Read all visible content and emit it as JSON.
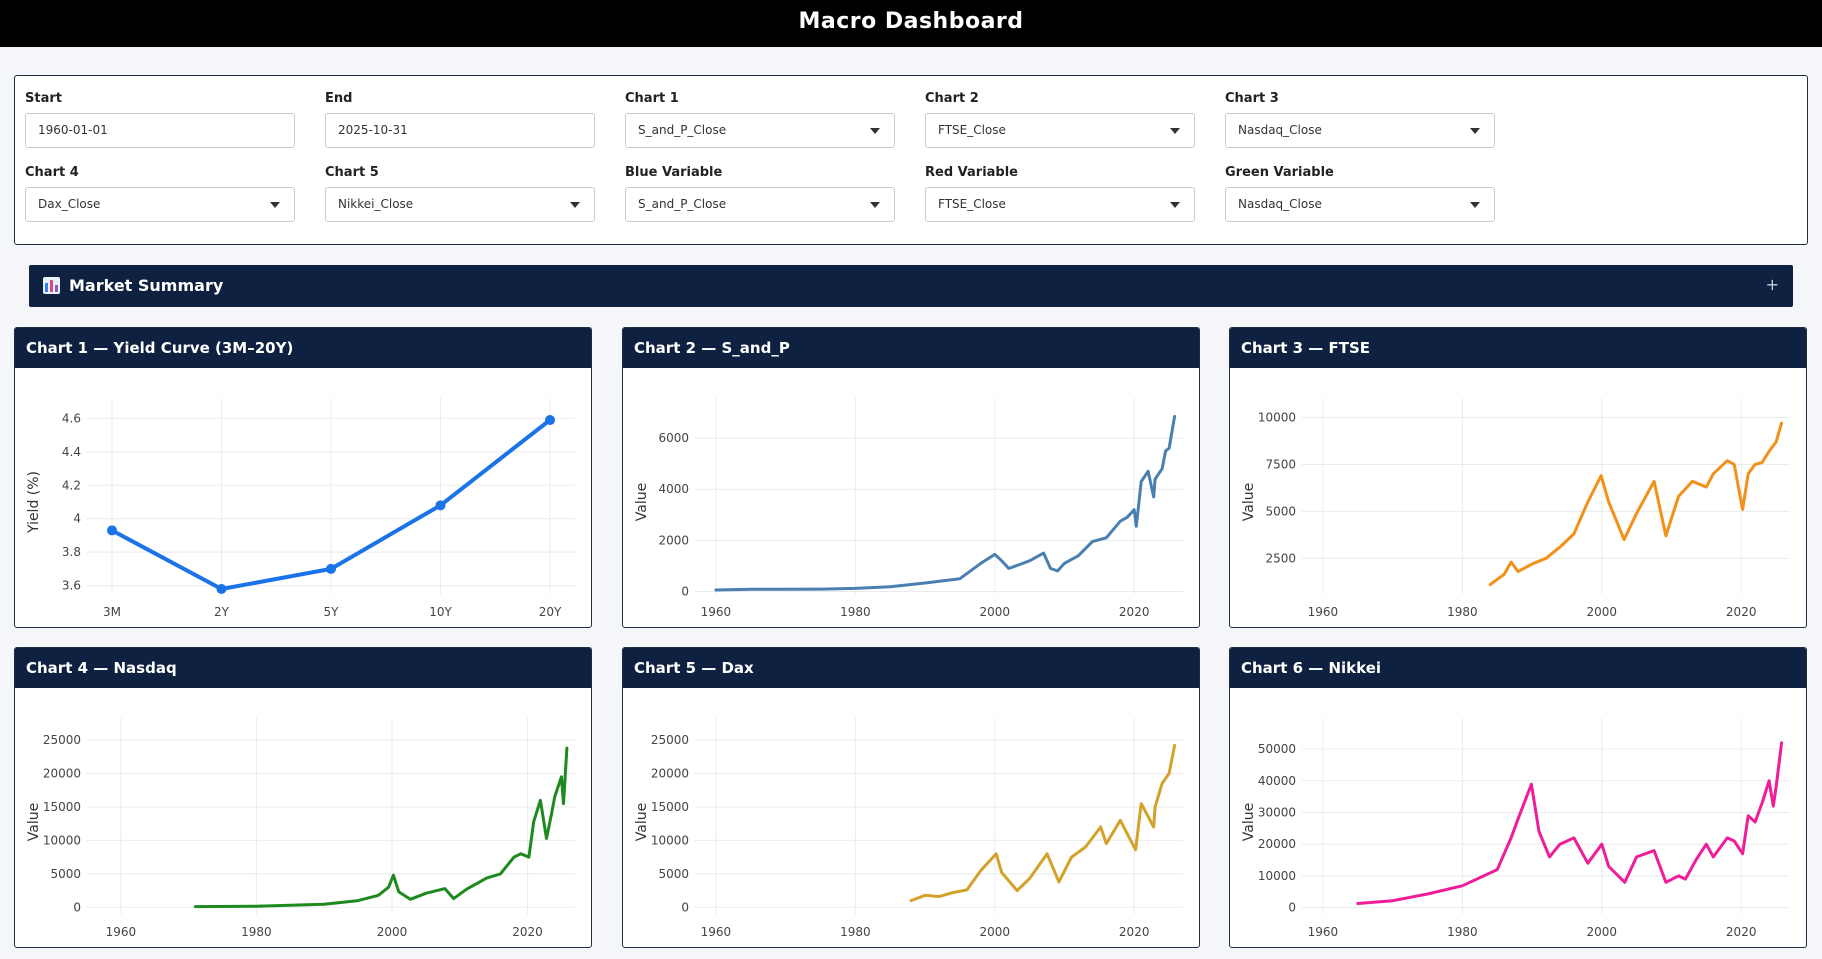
{
  "app": {
    "title": "Macro Dashboard"
  },
  "controls": {
    "start": {
      "label": "Start",
      "value": "1960-01-01"
    },
    "end": {
      "label": "End",
      "value": "2025-10-31"
    },
    "chart1": {
      "label": "Chart 1",
      "value": "S_and_P_Close"
    },
    "chart2": {
      "label": "Chart 2",
      "value": "FTSE_Close"
    },
    "chart3": {
      "label": "Chart 3",
      "value": "Nasdaq_Close"
    },
    "chart4": {
      "label": "Chart 4",
      "value": "Dax_Close"
    },
    "chart5": {
      "label": "Chart 5",
      "value": "Nikkei_Close"
    },
    "blue": {
      "label": "Blue Variable",
      "value": "S_and_P_Close"
    },
    "red": {
      "label": "Red Variable",
      "value": "FTSE_Close"
    },
    "green": {
      "label": "Green Variable",
      "value": "Nasdaq_Close"
    }
  },
  "summary": {
    "title": "Market Summary",
    "toggle": "+"
  },
  "cards": {
    "c1": "Chart 1 — Yield Curve (3M–20Y)",
    "c2": "Chart 2 — S_and_P",
    "c3": "Chart 3 — FTSE",
    "c4": "Chart 4 — Nasdaq",
    "c5": "Chart 5 — Dax",
    "c6": "Chart 6 — Nikkei"
  },
  "chart_data": [
    {
      "id": "c1",
      "type": "line",
      "ylabel": "Yield (%)",
      "color": "#1a73e8",
      "markers": true,
      "categories": [
        "3M",
        "2Y",
        "5Y",
        "10Y",
        "20Y"
      ],
      "values": [
        3.93,
        3.58,
        3.7,
        4.08,
        4.59
      ],
      "ylim": [
        3.55,
        4.65
      ],
      "yticks": [
        3.6,
        3.8,
        4.0,
        4.2,
        4.4,
        4.6
      ]
    },
    {
      "id": "c2",
      "type": "line",
      "ylabel": "Value",
      "color": "#4a7fb0",
      "xlim": [
        1957,
        2027
      ],
      "xticks": [
        1960,
        1980,
        2000,
        2020
      ],
      "ylim": [
        -100,
        7100
      ],
      "yticks": [
        0,
        2000,
        4000,
        6000
      ],
      "x": [
        1960,
        1965,
        1970,
        1975,
        1980,
        1985,
        1990,
        1995,
        1997,
        1998,
        2000,
        2001,
        2002,
        2003,
        2005,
        2007,
        2008,
        2009,
        2010,
        2012,
        2014,
        2016,
        2018,
        2019,
        2020,
        2020.3,
        2021,
        2022,
        2022.8,
        2023,
        2024,
        2024.5,
        2025,
        2025.8
      ],
      "y": [
        57,
        88,
        83,
        90,
        118,
        180,
        330,
        500,
        900,
        1100,
        1450,
        1200,
        900,
        1000,
        1200,
        1500,
        900,
        800,
        1100,
        1400,
        1950,
        2100,
        2750,
        2900,
        3200,
        2550,
        4300,
        4700,
        3700,
        4400,
        4800,
        5500,
        5600,
        6850
      ]
    },
    {
      "id": "c3",
      "type": "line",
      "ylabel": "Value",
      "color": "#f39018",
      "xlim": [
        1957,
        2027
      ],
      "xticks": [
        1960,
        1980,
        2000,
        2020
      ],
      "ylim": [
        600,
        10400
      ],
      "yticks": [
        2500,
        5000,
        7500,
        10000
      ],
      "x": [
        1984,
        1986,
        1987,
        1988,
        1990,
        1992,
        1994,
        1996,
        1998,
        1999.9,
        2001,
        2003.2,
        2005,
        2007.5,
        2009.2,
        2011,
        2013,
        2015,
        2016,
        2018,
        2019,
        2020.2,
        2021,
        2022,
        2023,
        2024,
        2025,
        2025.8
      ],
      "y": [
        1100,
        1650,
        2300,
        1800,
        2200,
        2500,
        3100,
        3800,
        5500,
        6900,
        5500,
        3500,
        4900,
        6600,
        3700,
        5800,
        6600,
        6300,
        7000,
        7700,
        7500,
        5100,
        7000,
        7500,
        7600,
        8200,
        8700,
        9700
      ]
    },
    {
      "id": "c4",
      "type": "line",
      "ylabel": "Value",
      "color": "#1e8a1e",
      "xlim": [
        1955,
        2027
      ],
      "xticks": [
        1960,
        1980,
        2000,
        2020
      ],
      "ylim": [
        -1000,
        26500
      ],
      "yticks": [
        0,
        5000,
        10000,
        15000,
        20000,
        25000
      ],
      "x": [
        1971,
        1980,
        1990,
        1995,
        1998,
        1999.5,
        2000.2,
        2001,
        2002.7,
        2005,
        2007.8,
        2009.1,
        2011,
        2014,
        2016,
        2018,
        2019,
        2020.2,
        2020.9,
        2021.9,
        2022.8,
        2023.5,
        2024,
        2025,
        2025.3,
        2025.8
      ],
      "y": [
        100,
        150,
        450,
        1000,
        1800,
        3000,
        4800,
        2300,
        1200,
        2100,
        2800,
        1300,
        2700,
        4400,
        5000,
        7500,
        8000,
        7500,
        12800,
        16000,
        10300,
        13800,
        16500,
        19500,
        15500,
        23800
      ]
    },
    {
      "id": "c5",
      "type": "line",
      "ylabel": "Value",
      "color": "#d4a22b",
      "xlim": [
        1957,
        2027
      ],
      "xticks": [
        1960,
        1980,
        2000,
        2020
      ],
      "ylim": [
        -1000,
        26500
      ],
      "yticks": [
        0,
        5000,
        10000,
        15000,
        20000,
        25000
      ],
      "x": [
        1988,
        1990,
        1992,
        1994,
        1996,
        1998,
        2000.2,
        2001,
        2003.2,
        2005,
        2007.5,
        2009.2,
        2011,
        2013,
        2015.2,
        2016,
        2018,
        2019,
        2020.2,
        2021,
        2022.8,
        2023,
        2024,
        2025,
        2025.8
      ],
      "y": [
        1000,
        1800,
        1600,
        2200,
        2600,
        5500,
        8000,
        5200,
        2500,
        4300,
        8000,
        3800,
        7500,
        9000,
        12000,
        9500,
        13000,
        11000,
        8600,
        15500,
        12000,
        15000,
        18500,
        20000,
        24200
      ]
    },
    {
      "id": "c6",
      "type": "line",
      "ylabel": "Value",
      "color": "#f01d9a",
      "xlim": [
        1957,
        2027
      ],
      "xticks": [
        1960,
        1980,
        2000,
        2020
      ],
      "ylim": [
        -2000,
        56000
      ],
      "yticks": [
        0,
        10000,
        20000,
        30000,
        40000,
        50000
      ],
      "x": [
        1965,
        1970,
        1975,
        1980,
        1985,
        1987,
        1988,
        1989.9,
        1991,
        1992.5,
        1994,
        1996,
        1998,
        2000,
        2001,
        2003.3,
        2005,
        2007.5,
        2009.2,
        2011,
        2012,
        2013.5,
        2015,
        2016,
        2018,
        2019,
        2020.2,
        2021,
        2022,
        2023,
        2024,
        2024.6,
        2025,
        2025.8
      ],
      "y": [
        1300,
        2200,
        4300,
        6900,
        12000,
        22000,
        28000,
        38900,
        24000,
        16000,
        20000,
        22000,
        14000,
        20000,
        13000,
        8000,
        16000,
        18000,
        8000,
        10000,
        9000,
        15000,
        20000,
        16000,
        22000,
        21000,
        17000,
        29000,
        27000,
        33000,
        40000,
        32000,
        38000,
        52000
      ]
    }
  ]
}
